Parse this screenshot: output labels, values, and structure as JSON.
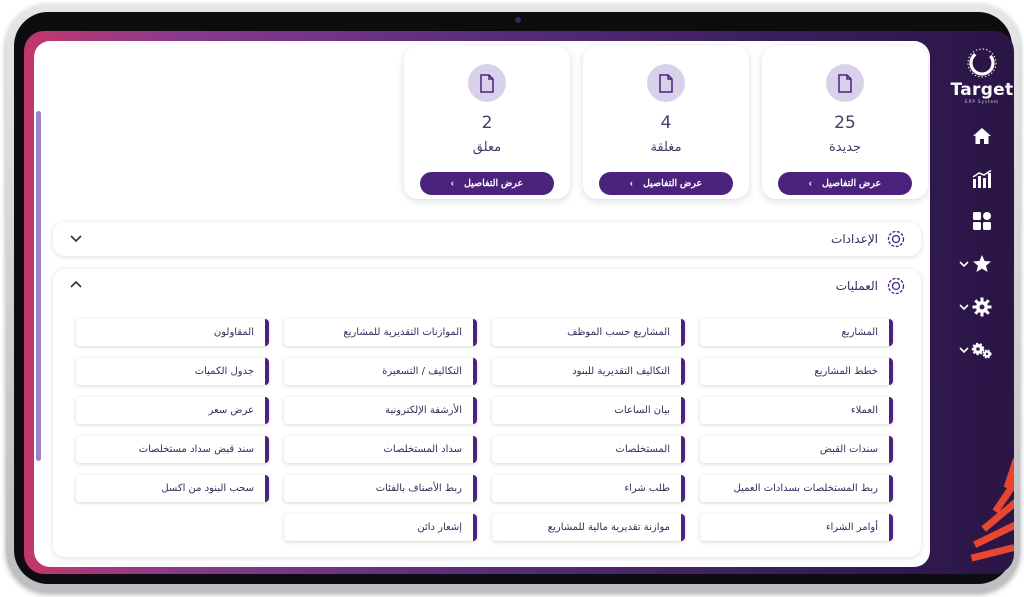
{
  "brand": {
    "name": "Target",
    "tagline": "ERP System"
  },
  "summary_cards": [
    {
      "count": "25",
      "label": "جديدة",
      "button": "عرض التفاصيل"
    },
    {
      "count": "4",
      "label": "مغلقة",
      "button": "عرض التفاصيل"
    },
    {
      "count": "2",
      "label": "معلق",
      "button": "عرض التفاصيل"
    }
  ],
  "sections": {
    "settings": {
      "title": "الإعدادات"
    },
    "operations": {
      "title": "العمليات"
    }
  },
  "operations_items": {
    "col1": [
      "المشاريع",
      "خطط المشاريع",
      "العملاء",
      "سندات القبض",
      "ربط المستخلصات بسدادات العميل",
      "أوامر الشراء"
    ],
    "col2": [
      "المشاريع حسب الموظف",
      "التكاليف التقديرية للبنود",
      "بيان الساعات",
      "المستخلصات",
      "طلب شراء",
      "موازنة تقديرية مالية للمشاريع"
    ],
    "col3": [
      "الموازنات التقديرية للمشاريع",
      "التكاليف / التسعيرة",
      "الأرشفة الإلكترونية",
      "سداد المستخلصات",
      "ربط الأصناف بالفئات",
      "إشعار دائن"
    ],
    "col4": [
      "المقاولون",
      "جدول الكميات",
      "عرض سعر",
      "سند قبض سداد مستخلصات",
      "سحب البنود من اكسل"
    ]
  },
  "colors": {
    "accent": "#4b237c",
    "icon_bg": "#d9d1ea",
    "text": "#3a2a5a"
  },
  "icons": [
    "home-icon",
    "chart-icon",
    "apps-icon",
    "star-icon",
    "gear-icon",
    "gears-icon",
    "document-icon",
    "chevron-left-icon",
    "chevron-down-icon",
    "chevron-up-icon",
    "settings-section-icon"
  ]
}
